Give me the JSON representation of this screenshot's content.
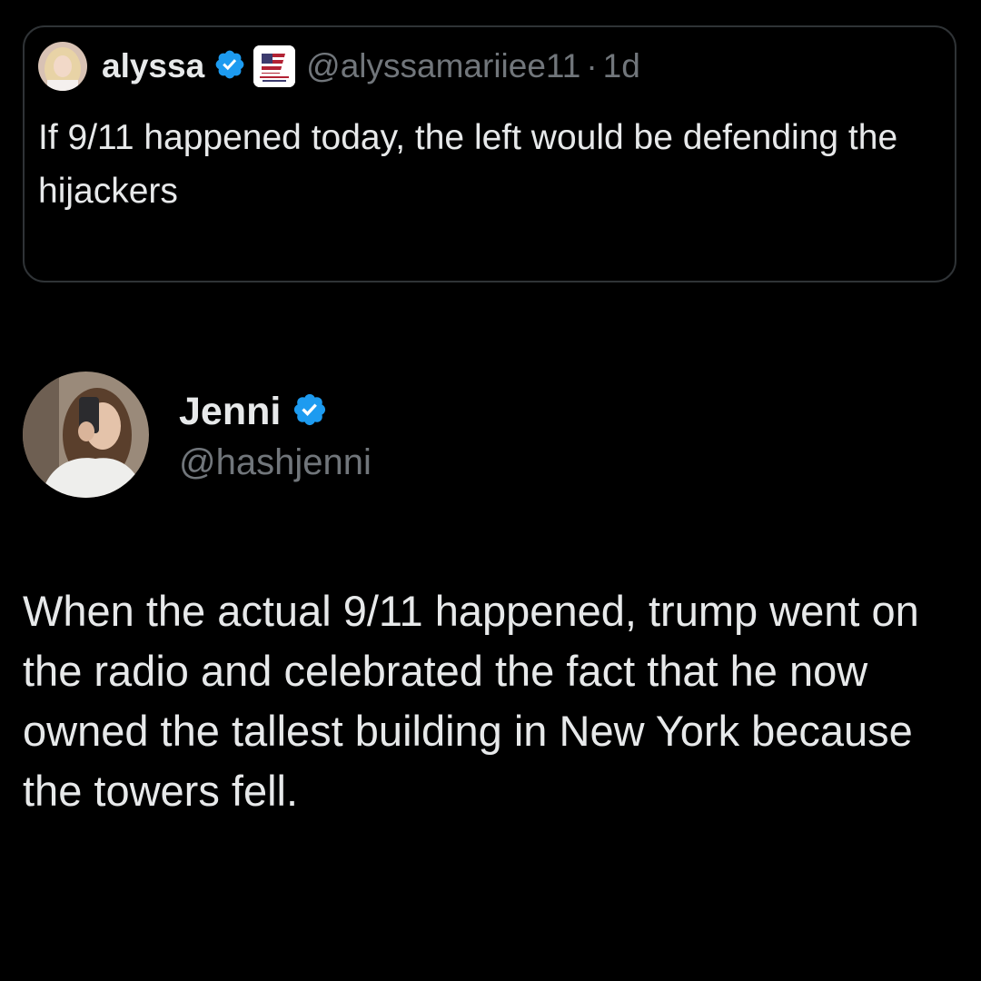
{
  "quoted_post": {
    "author_name": "alyssa",
    "handle": "@alyssamariiee11",
    "separator": "·",
    "time": "1d",
    "text": "If 9/11 happened today, the left would be defending the hijackers"
  },
  "post": {
    "author_name": "Jenni",
    "handle": "@hashjenni",
    "text": "When the actual 9/11 happened, trump went on the radio and celebrated the fact that he now owned the tallest building in New York because the towers fell."
  },
  "icons": {
    "verified": "verified-check-icon",
    "affiliation": "us-flag-affiliation-badge"
  },
  "colors": {
    "background": "#000000",
    "text_primary": "#e7e9ea",
    "text_secondary": "#71767b",
    "card_border": "#2f3336",
    "verified_blue": "#1d9bf0"
  }
}
